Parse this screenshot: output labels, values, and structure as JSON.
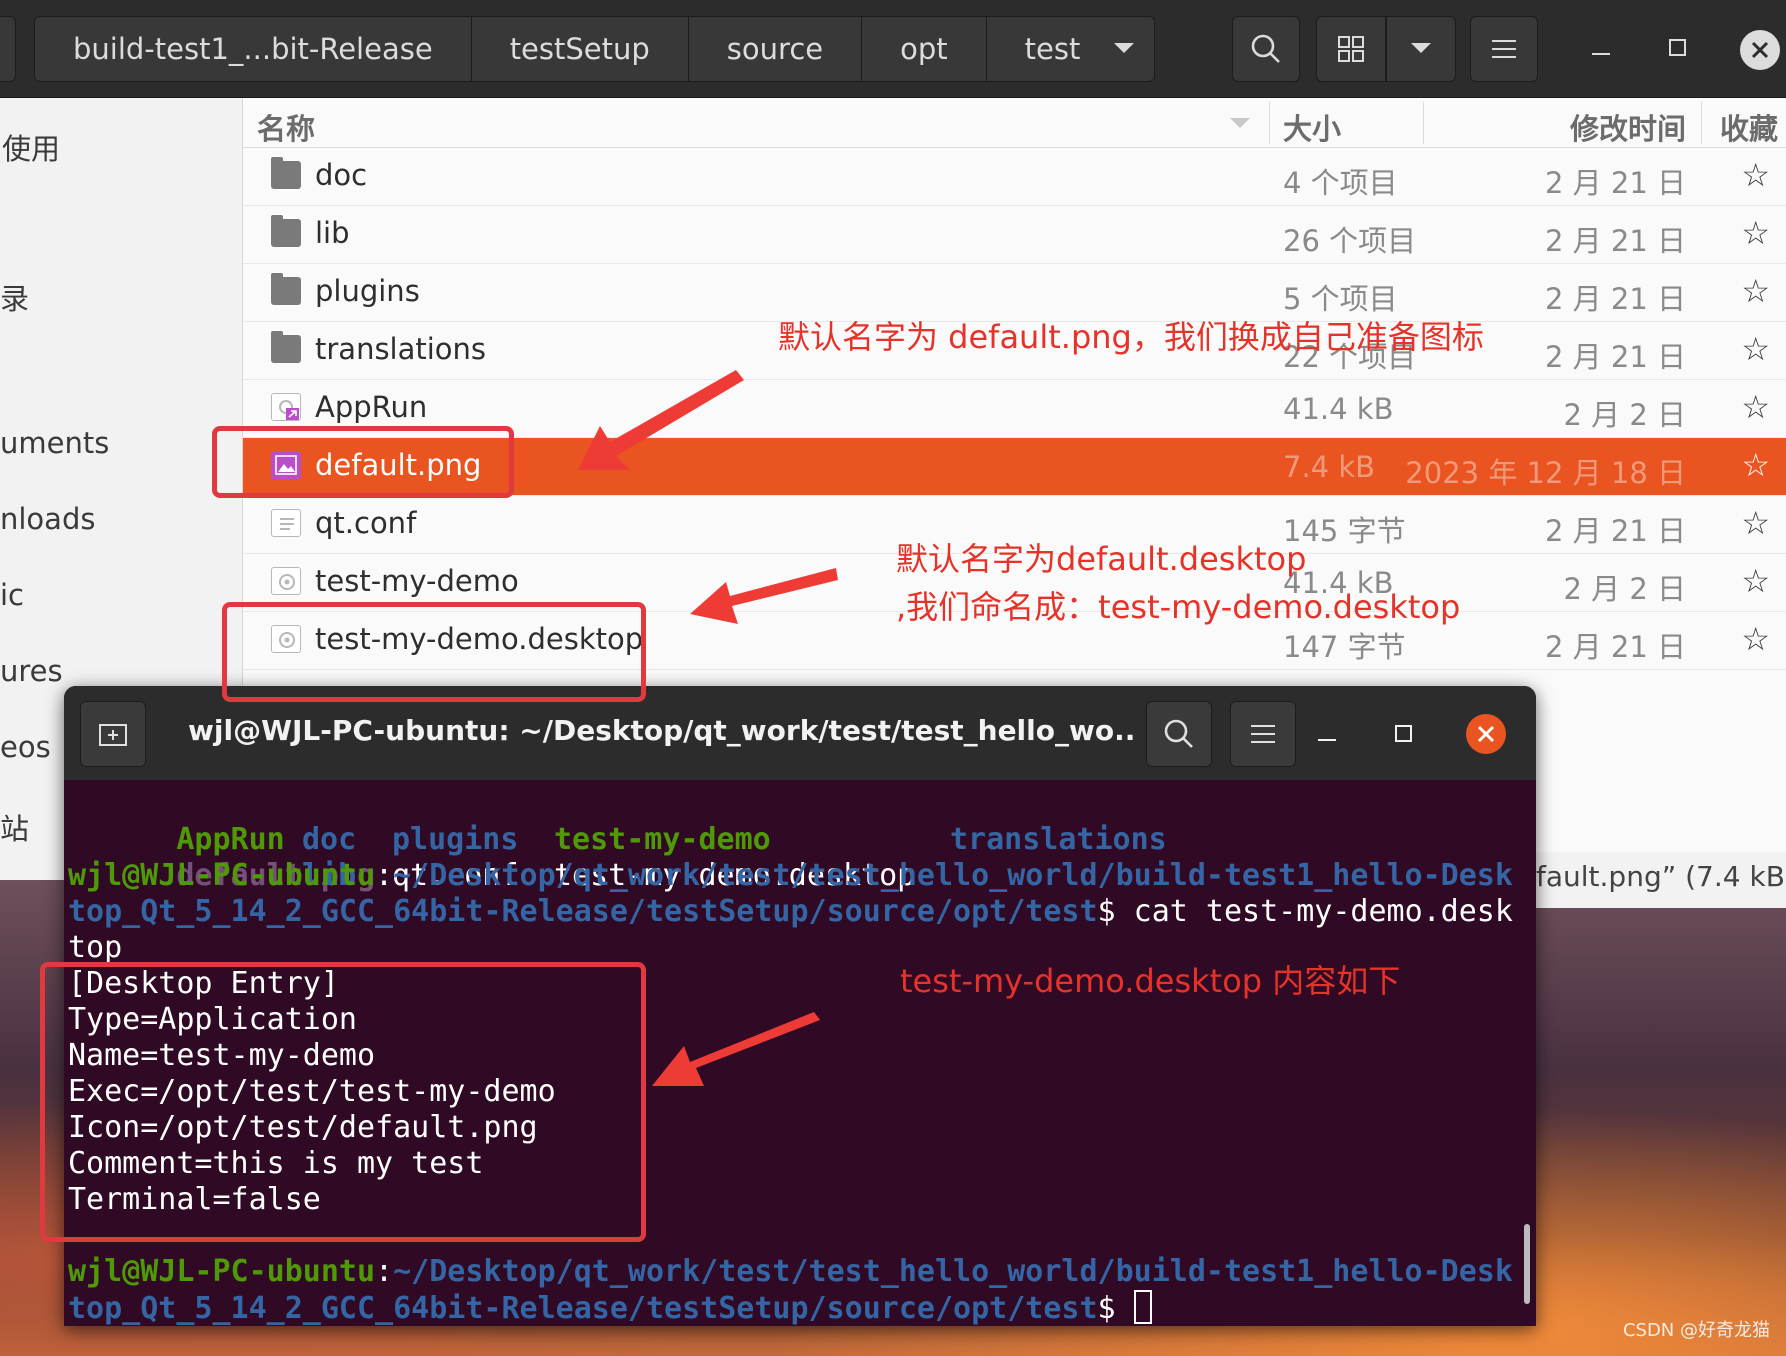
{
  "files": {
    "path_crumbs": [
      "build-test1_...bit-Release",
      "testSetup",
      "source",
      "opt",
      "test"
    ],
    "sidebar_items": [
      "使用",
      "录",
      "uments",
      "nloads",
      "ic",
      "ures",
      "eos",
      "站"
    ],
    "columns": {
      "name": "名称",
      "size": "大小",
      "modified": "修改时间",
      "starred": "收藏"
    },
    "rows": [
      {
        "name": "doc",
        "size": "4 个项目",
        "date": "2 月 21 日",
        "icon": "folder-icon"
      },
      {
        "name": "lib",
        "size": "26 个项目",
        "date": "2 月 21 日",
        "icon": "folder-icon"
      },
      {
        "name": "plugins",
        "size": "5 个项目",
        "date": "2 月 21 日",
        "icon": "folder-icon"
      },
      {
        "name": "translations",
        "size": "22 个项目",
        "date": "2 月 21 日",
        "icon": "folder-icon"
      },
      {
        "name": "AppRun",
        "size": "41.4 kB",
        "date": "2 月 2 日",
        "icon": "symlink-exec-icon"
      },
      {
        "name": "default.png",
        "size": "7.4 kB",
        "date": "2023 年 12 月 18 日",
        "icon": "image-icon"
      },
      {
        "name": "qt.conf",
        "size": "145 字节",
        "date": "2 月 21 日",
        "icon": "text-file-icon"
      },
      {
        "name": "test-my-demo",
        "size": "41.4 kB",
        "date": "2 月 2 日",
        "icon": "executable-icon"
      },
      {
        "name": "test-my-demo.desktop",
        "size": "147 字节",
        "date": "2 月 21 日",
        "icon": "desktop-file-icon"
      }
    ],
    "star_glyph": "☆",
    "status_text": "fault.png” (7.4 kB)",
    "selected_color": "#e95420"
  },
  "terminal": {
    "title": "wjl@WJL-PC-ubuntu: ~/Desktop/qt_work/test/test_hello_wo...",
    "ls_row1": {
      "a": "AppRun",
      "b": "doc",
      "c": "plugins",
      "d": "test-my-demo",
      "e": "translations"
    },
    "ls_row2": {
      "a": "default.png",
      "b": "lib",
      "c": "qt.conf",
      "d": "test-my-demo.desktop"
    },
    "prompt_user": "wjl@WJL-PC-ubuntu",
    "prompt_path_1": "~/Desktop/qt_work/test/test_hello_world/build-test1_hello-Desk",
    "prompt_path_2": "top_Qt_5_14_2_GCC_64bit-Release/testSetup/source/opt/test",
    "command": " cat test-my-demo.desk",
    "command_wrap": "top",
    "file_lines": [
      "[Desktop Entry]",
      "Type=Application",
      "Name=test-my-demo",
      "Exec=/opt/test/test-my-demo",
      "Icon=/opt/test/default.png",
      "Comment=this is my test",
      "Terminal=false"
    ],
    "colon": ":",
    "dollar": "$"
  },
  "annotations": {
    "note_png": "默认名字为 default.png，我们换成自己准备图标",
    "note_desktop_1": "默认名字为default.desktop",
    "note_desktop_2": ",我们命名成：test-my-demo.desktop",
    "note_content": "test-my-demo.desktop 内容如下",
    "color": "#e5332a"
  },
  "watermark": "CSDN @好奇龙猫"
}
